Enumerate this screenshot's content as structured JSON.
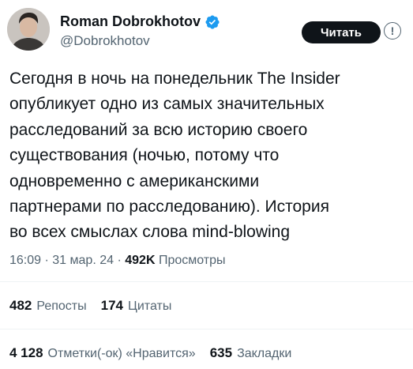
{
  "author": {
    "display_name": "Roman Dobrokhotov",
    "handle": "@Dobrokhotov",
    "verified_icon": "verified-badge-icon",
    "verified_color": "#1d9bf0"
  },
  "follow_button_label": "Читать",
  "more_icon": "info-icon",
  "tweet_lines": [
    "Сегодня в ночь на понедельник The Insider",
    "опубликует одно из самых значительных",
    "расследований за всю историю своего",
    "существования (ночью, потому что",
    "одновременно с американскими",
    "партнерами по расследованию). История",
    "во всех смыслах слова mind-blowing"
  ],
  "meta": {
    "time": "16:09",
    "date": "31 мар. 24",
    "separator": "·",
    "views_count": "492K",
    "views_label": "Просмотры"
  },
  "stats_row1": [
    {
      "count": "482",
      "label": "Репосты"
    },
    {
      "count": "174",
      "label": "Цитаты"
    }
  ],
  "stats_row2": [
    {
      "count": "4 128",
      "label": "Отметки(-ок) «Нравится»"
    },
    {
      "count": "635",
      "label": "Закладки"
    }
  ],
  "colors": {
    "text_primary": "#0f1419",
    "text_secondary": "#536471",
    "divider": "#eff3f4",
    "button_bg": "#0f1419"
  }
}
